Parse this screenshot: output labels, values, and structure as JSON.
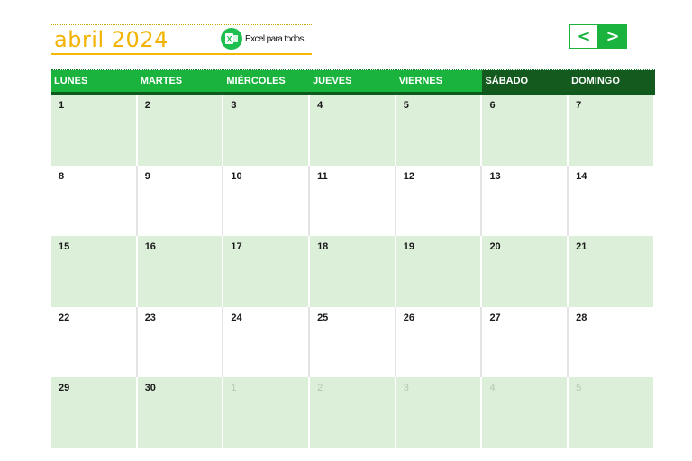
{
  "header": {
    "month_title": "abril 2024",
    "brand_text": "Excel para todos",
    "brand_logo_letter": "X"
  },
  "nav": {
    "prev_label": "<",
    "next_label": ">"
  },
  "colors": {
    "accent": "#19b33e",
    "weekend_header": "#145a1e",
    "title": "#f2b300",
    "shaded_row": "#dcefd8"
  },
  "calendar": {
    "weekdays": [
      "LUNES",
      "MARTES",
      "MIÉRCOLES",
      "JUEVES",
      "VIERNES",
      "SÁBADO",
      "DOMINGO"
    ],
    "weeks": [
      [
        "1",
        "2",
        "3",
        "4",
        "5",
        "6",
        "7"
      ],
      [
        "8",
        "9",
        "10",
        "11",
        "12",
        "13",
        "14"
      ],
      [
        "15",
        "16",
        "17",
        "18",
        "19",
        "20",
        "21"
      ],
      [
        "22",
        "23",
        "24",
        "25",
        "26",
        "27",
        "28"
      ],
      [
        "29",
        "30",
        "1",
        "2",
        "3",
        "4",
        "5"
      ]
    ]
  }
}
